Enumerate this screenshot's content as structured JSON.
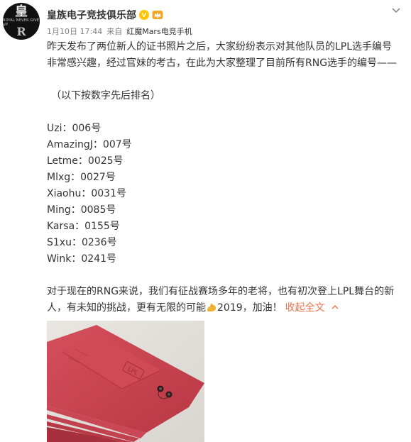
{
  "account": {
    "name": "皇族电子竞技俱乐部",
    "avatar_text": "皇",
    "avatar_sub": "ROYAL NEVER GIVE UP",
    "avatar_mark": "R"
  },
  "meta": {
    "time": "1月10日 17:44",
    "source_prefix": "来自",
    "source": "红魔Mars电竞手机"
  },
  "post": {
    "intro": "昨天发布了两位新人的证书照片之后，大家纷纷表示对其他队员的LPL选手编号非常感兴趣，经过官妹的考古，在此为大家整理了目前所有RNG选手的编号——",
    "note": "（以下按数字先后排名）",
    "players": [
      "Uzi：006号",
      "AmazingJ：007号",
      "Letme：0025号",
      "Mlxg：0027号",
      "Xiaohu：0031号",
      "Ming：0085号",
      "Karsa：0155号",
      "S1xu：0236号",
      "Wink：0241号"
    ],
    "closing": "对于现在的RNG来说，我们有征战赛场多年的老将，也有初次登上LPL舞台的新人，有未知的挑战，更有无限的可能",
    "closing_tail": "2019，加油！",
    "collapse_label": "收起全文",
    "emoji": "flexed-biceps-emoji"
  },
  "photo": {
    "logo_text": "LPL"
  },
  "colors": {
    "link": "#eb7350",
    "verified": "#ffc600",
    "text": "#333333",
    "meta": "#808080",
    "envelope": "#c8414d"
  }
}
